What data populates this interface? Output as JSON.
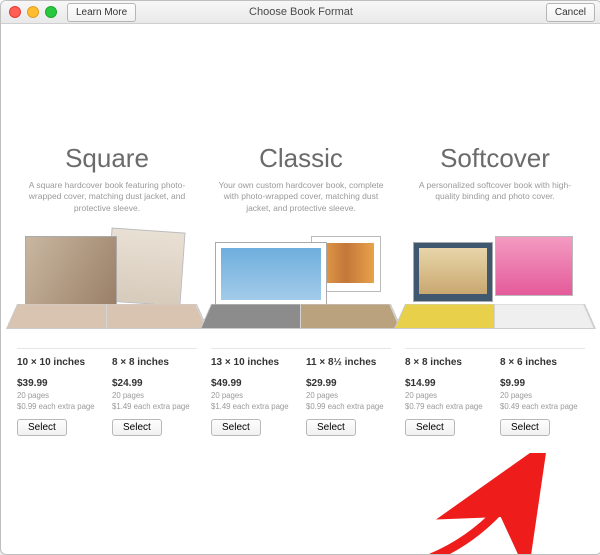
{
  "window": {
    "title": "Choose Book Format",
    "learn_more": "Learn More",
    "cancel": "Cancel"
  },
  "formats": [
    {
      "name": "Square",
      "desc": "A square hardcover book featuring photo-wrapped cover, matching dust jacket, and protective sleeve.",
      "options": [
        {
          "size": "10 × 10 inches",
          "price": "$39.99",
          "pages": "20 pages",
          "extra": "$0.99 each extra page"
        },
        {
          "size": "8 × 8 inches",
          "price": "$24.99",
          "pages": "20 pages",
          "extra": "$1.49 each extra page"
        }
      ]
    },
    {
      "name": "Classic",
      "desc": "Your own custom hardcover book, complete with photo-wrapped cover, matching dust jacket, and protective sleeve.",
      "options": [
        {
          "size": "13 × 10 inches",
          "price": "$49.99",
          "pages": "20 pages",
          "extra": "$1.49 each extra page"
        },
        {
          "size": "11 × 8½ inches",
          "price": "$29.99",
          "pages": "20 pages",
          "extra": "$0.99 each extra page"
        }
      ]
    },
    {
      "name": "Softcover",
      "desc": "A personalized softcover book with high-quality binding and photo cover.",
      "options": [
        {
          "size": "8 × 8 inches",
          "price": "$14.99",
          "pages": "20 pages",
          "extra": "$0.79 each extra page"
        },
        {
          "size": "8 × 6 inches",
          "price": "$9.99",
          "pages": "20 pages",
          "extra": "$0.49 each extra page"
        }
      ]
    }
  ],
  "select_label": "Select"
}
